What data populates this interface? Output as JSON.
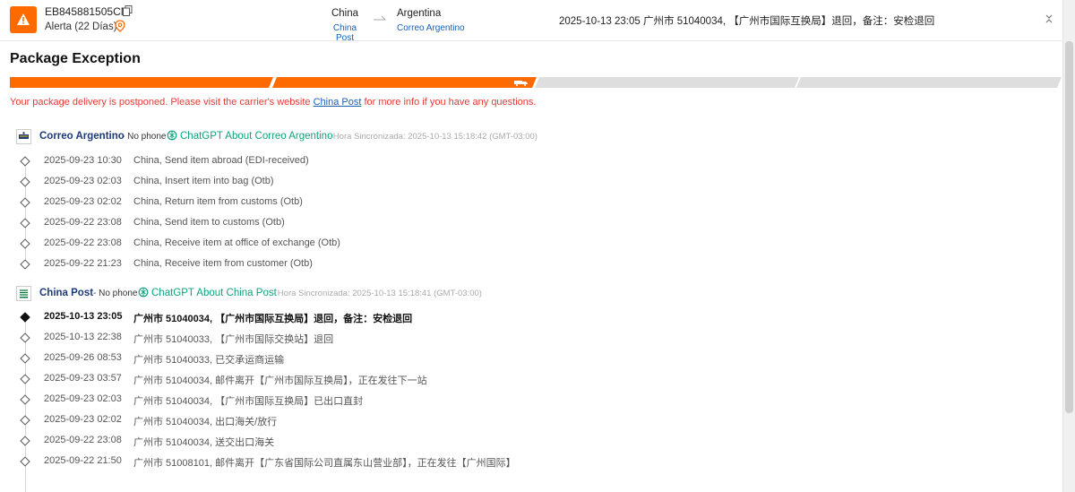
{
  "header": {
    "tracking_number": "EB845881505CN",
    "alert_status": "Alerta (22 Días)",
    "origin_country": "China",
    "origin_carrier": "China Post",
    "destination_country": "Argentina",
    "destination_carrier": "Correo Argentino",
    "latest_event": "2025-10-13 23:05  广州市 51040034, 【广州市国际互换局】退回，备注：安检退回"
  },
  "title": "Package Exception",
  "progress": {
    "completed_steps": 2,
    "total_steps": 4
  },
  "notice": {
    "before": "Your package delivery is postponed. Please visit the carrier's website ",
    "link": "China Post",
    "after": " for more info if you have any questions."
  },
  "carriers": [
    {
      "name": "Correo Argentino",
      "phone": "- No phone",
      "gpt_label": "ChatGPT About Correo Argentino",
      "sync": "- Hora Sincronizada: 2025-10-13 15:18:42 (GMT-03:00)",
      "events": [
        {
          "time": "2025-09-23 10:30",
          "desc": "China, Send item abroad (EDI-received)"
        },
        {
          "time": "2025-09-23 02:03",
          "desc": "China, Insert item into bag (Otb)"
        },
        {
          "time": "2025-09-23 02:02",
          "desc": "China, Return item from customs (Otb)"
        },
        {
          "time": "2025-09-22 23:08",
          "desc": "China, Send item to customs (Otb)"
        },
        {
          "time": "2025-09-22 23:08",
          "desc": "China, Receive item at office of exchange (Otb)"
        },
        {
          "time": "2025-09-22 21:23",
          "desc": "China, Receive item from customer (Otb)"
        }
      ]
    },
    {
      "name": "China Post",
      "phone": "- No phone",
      "gpt_label": "ChatGPT About China Post",
      "sync": "- Hora Sincronizada: 2025-10-13 15:18:41 (GMT-03:00)",
      "events": [
        {
          "time": "2025-10-13 23:05",
          "desc": "广州市 51040034, 【广州市国际互换局】退回，备注：安检退回"
        },
        {
          "time": "2025-10-13 22:38",
          "desc": "广州市 51040033, 【广州市国际交换站】退回"
        },
        {
          "time": "2025-09-26 08:53",
          "desc": "广州市 51040033, 已交承运商运输"
        },
        {
          "time": "2025-09-23 03:57",
          "desc": "广州市 51040034, 邮件离开【广州市国际互换局】，正在发往下一站"
        },
        {
          "time": "2025-09-23 02:03",
          "desc": "广州市 51040034, 【广州市国际互换局】已出口直封"
        },
        {
          "time": "2025-09-23 02:02",
          "desc": "广州市 51040034, 出口海关/放行"
        },
        {
          "time": "2025-09-22 23:08",
          "desc": "广州市 51040034, 送交出口海关"
        },
        {
          "time": "2025-09-22 21:50",
          "desc": "广州市 51008101, 邮件离开【广东省国际公司直属东山营业部】，正在发往【广州国际】"
        }
      ]
    }
  ]
}
